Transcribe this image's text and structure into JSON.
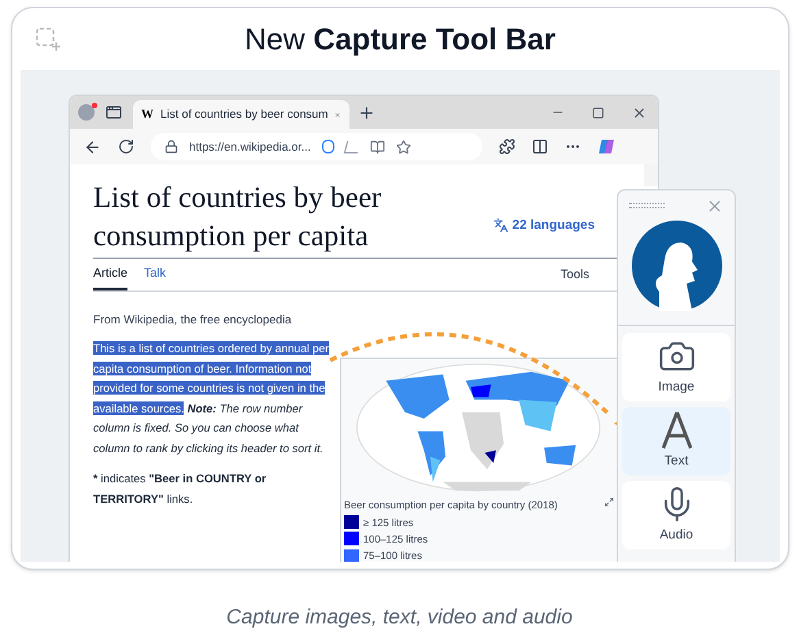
{
  "header": {
    "title": "New **Capture Tool Bar**"
  },
  "browser": {
    "favicon": "W",
    "tab_title": "List of countries by beer consum",
    "url": "https://en.wikipedia.or..."
  },
  "article": {
    "title": "List of countries by beer consumption per capita",
    "languages": "22 languages",
    "tabs": [
      {
        "label": "Article",
        "selected": true
      },
      {
        "label": "Talk",
        "selected": false
      }
    ],
    "tools": "Tools",
    "tagline": "From Wikipedia, the free encyclopedia",
    "selected_text": "This is a list of countries ordered by annual per capita consumption of beer. Information not provided for some countries is not given in the available sources.",
    "note": "**Note:** The row number column is fixed. So you can choose what column to rank by clicking its header to sort it.",
    "asterisk": "*",
    "indicates": "indicates **\"Beer in COUNTRY or TERRITORY\"** links.",
    "map_caption": "Beer consumption per capita by country (2018)",
    "legend": [
      {
        "label": "≥ 125 litres",
        "color": "#000099"
      },
      {
        "label": "100–125 litres",
        "color": "#0000ff"
      },
      {
        "label": "75–100 litres",
        "color": "#3366ff"
      }
    ]
  },
  "toolbar": {
    "items": [
      {
        "label": "Image",
        "kind": "image",
        "selected": false
      },
      {
        "label": "Text",
        "kind": "text",
        "selected": true
      },
      {
        "label": "Audio",
        "kind": "audio",
        "selected": false
      }
    ]
  },
  "caption": "Capture images, text, video and audio"
}
